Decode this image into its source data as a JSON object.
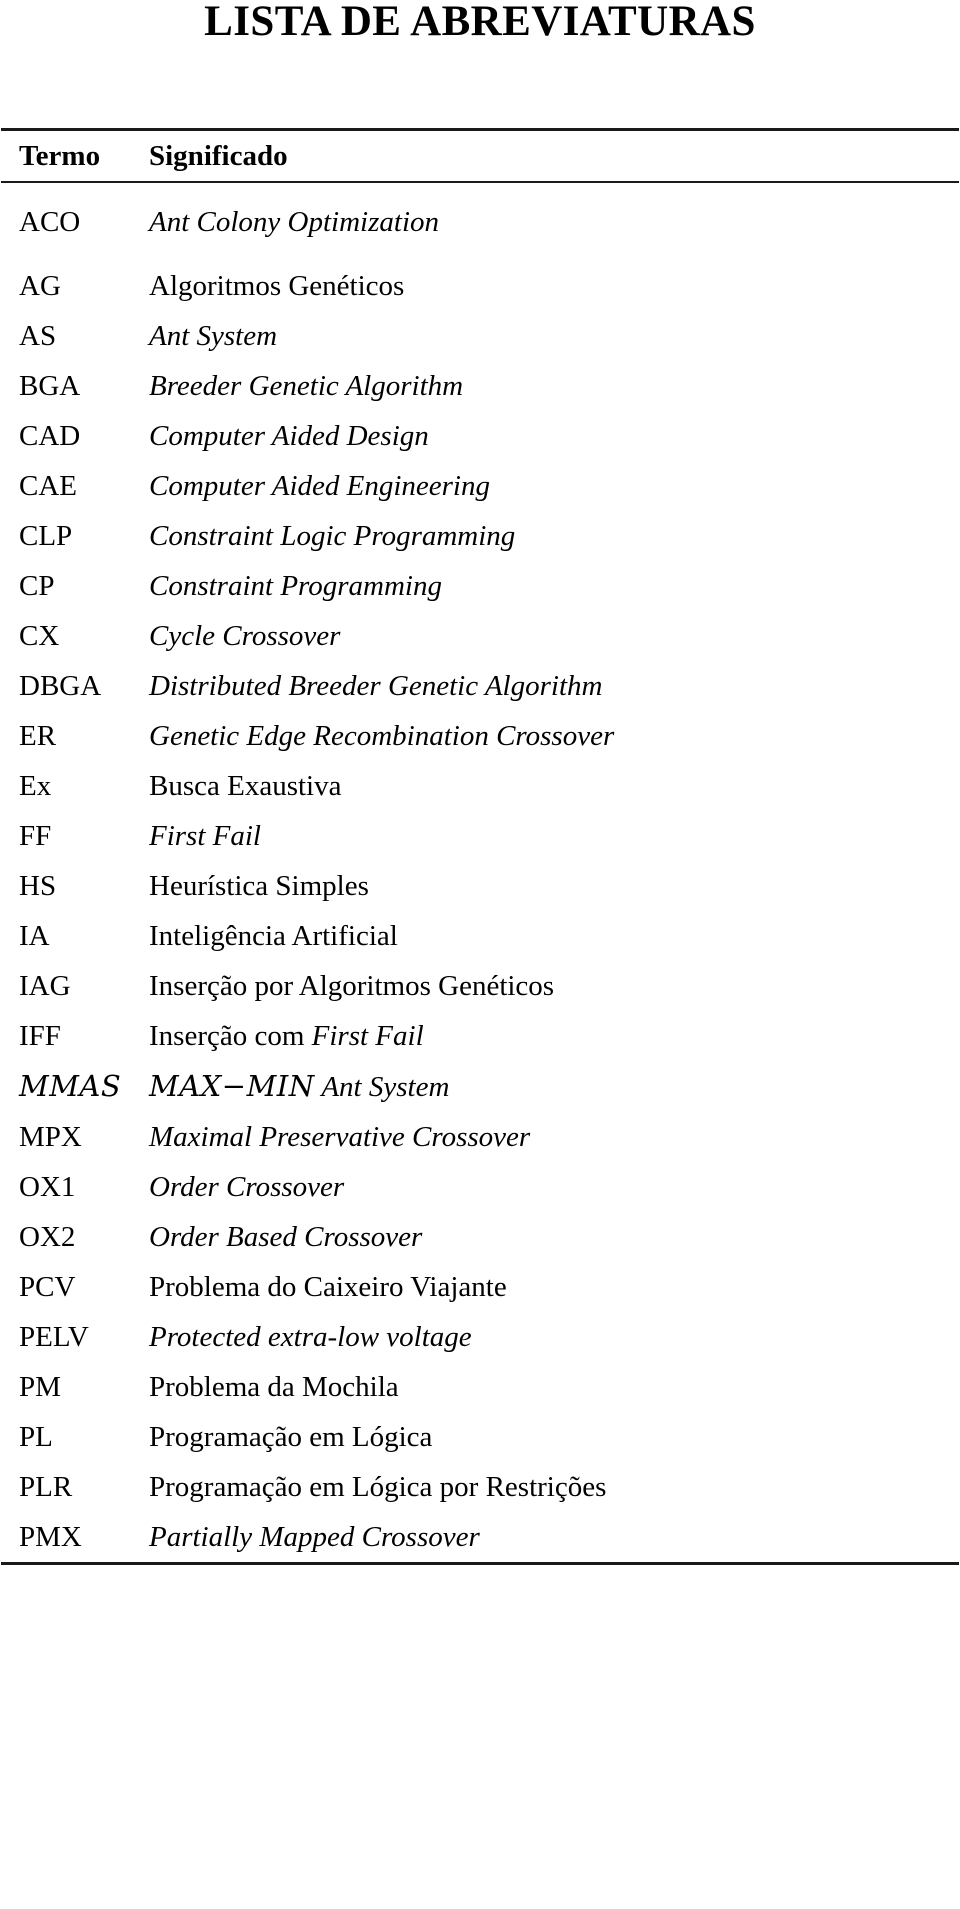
{
  "title": "LISTA DE ABREVIATURAS",
  "table": {
    "headers": {
      "term": "Termo",
      "meaning": "Significado"
    },
    "rows": [
      {
        "term": "ACO",
        "term_style": "roman",
        "definition": "Ant Colony Optimization",
        "def_style": "italic"
      },
      {
        "term": "AG",
        "term_style": "roman",
        "definition": "Algoritmos Genéticos",
        "def_style": "roman"
      },
      {
        "term": "AS",
        "term_style": "roman",
        "definition": "Ant System",
        "def_style": "italic"
      },
      {
        "term": "BGA",
        "term_style": "roman",
        "definition": "Breeder Genetic Algorithm",
        "def_style": "italic"
      },
      {
        "term": "CAD",
        "term_style": "roman",
        "definition": "Computer Aided Design",
        "def_style": "italic"
      },
      {
        "term": "CAE",
        "term_style": "roman",
        "definition": "Computer Aided Engineering",
        "def_style": "italic"
      },
      {
        "term": "CLP",
        "term_style": "roman",
        "definition": "Constraint Logic Programming",
        "def_style": "italic"
      },
      {
        "term": "CP",
        "term_style": "roman",
        "definition": "Constraint Programming",
        "def_style": "italic"
      },
      {
        "term": "CX",
        "term_style": "roman",
        "definition": "Cycle Crossover",
        "def_style": "italic"
      },
      {
        "term": "DBGA",
        "term_style": "roman",
        "definition": "Distributed Breeder Genetic Algorithm",
        "def_style": "italic"
      },
      {
        "term": "ER",
        "term_style": "roman",
        "definition": "Genetic Edge Recombination Crossover",
        "def_style": "italic"
      },
      {
        "term": "Ex",
        "term_style": "roman",
        "definition": "Busca Exaustiva",
        "def_style": "roman"
      },
      {
        "term": "FF",
        "term_style": "roman",
        "definition": "First Fail",
        "def_style": "italic"
      },
      {
        "term": "HS",
        "term_style": "roman",
        "definition": "Heurística Simples",
        "def_style": "roman"
      },
      {
        "term": "IA",
        "term_style": "roman",
        "definition": "Inteligência Artificial",
        "def_style": "roman"
      },
      {
        "term": "IAG",
        "term_style": "roman",
        "definition": "Inserção por Algoritmos Genéticos",
        "def_style": "roman"
      },
      {
        "term": "IFF",
        "term_style": "roman",
        "definition": "Inserção com First Fail",
        "def_style": "mixed",
        "def_parts": [
          {
            "text": "Inserção com ",
            "style": "roman"
          },
          {
            "text": "First Fail",
            "style": "italic"
          }
        ]
      },
      {
        "term": "MMAS",
        "term_style": "calligraphic",
        "definition": "MAX−MIN Ant System",
        "def_style": "calligraphic-mixed",
        "def_parts": [
          {
            "text": "MAX−MIN",
            "style": "calligraphic"
          },
          {
            "text": " Ant System",
            "style": "italic"
          }
        ]
      },
      {
        "term": "MPX",
        "term_style": "roman",
        "definition": "Maximal Preservative Crossover",
        "def_style": "italic"
      },
      {
        "term": "OX1",
        "term_style": "roman",
        "definition": "Order Crossover",
        "def_style": "italic"
      },
      {
        "term": "OX2",
        "term_style": "roman",
        "definition": "Order Based Crossover",
        "def_style": "italic"
      },
      {
        "term": "PCV",
        "term_style": "roman",
        "definition": "Problema do Caixeiro Viajante",
        "def_style": "roman"
      },
      {
        "term": "PELV",
        "term_style": "roman",
        "definition": "Protected extra-low voltage",
        "def_style": "italic"
      },
      {
        "term": "PM",
        "term_style": "roman",
        "definition": "Problema da Mochila",
        "def_style": "roman"
      },
      {
        "term": "PL",
        "term_style": "roman",
        "definition": "Programação em Lógica",
        "def_style": "roman"
      },
      {
        "term": "PLR",
        "term_style": "roman",
        "definition": "Programação em Lógica por Restrições",
        "def_style": "roman"
      },
      {
        "term": "PMX",
        "term_style": "roman",
        "definition": "Partially Mapped Crossover",
        "def_style": "italic"
      }
    ]
  },
  "colors": {
    "text": "#000000",
    "rule": "#1a1a1a",
    "background": "#ffffff"
  }
}
